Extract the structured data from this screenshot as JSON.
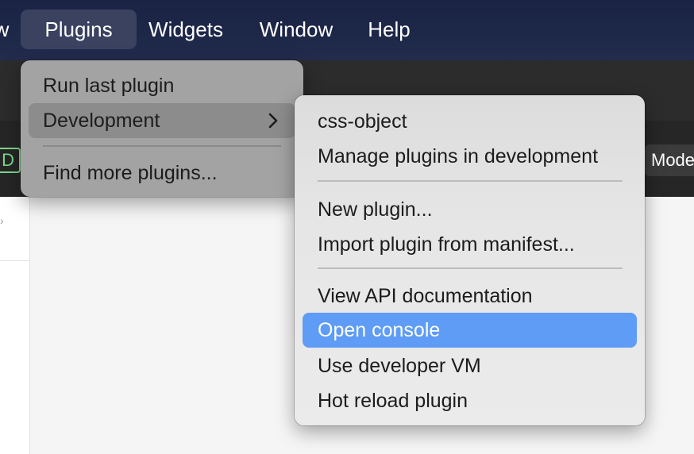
{
  "menubar": {
    "items": [
      {
        "label": "w"
      },
      {
        "label": "Plugins"
      },
      {
        "label": "Widgets"
      },
      {
        "label": "Window"
      },
      {
        "label": "Help"
      }
    ]
  },
  "toolbar": {
    "left_label": "k D",
    "mode_button": "Mode"
  },
  "plugins_menu": {
    "run_last": "Run last plugin",
    "development": "Development",
    "find_more": "Find more plugins..."
  },
  "development_menu": {
    "items": [
      {
        "label": "css-object"
      },
      {
        "label": "Manage plugins in development"
      },
      {
        "label": "New plugin..."
      },
      {
        "label": "Import plugin from manifest..."
      },
      {
        "label": "View API documentation"
      },
      {
        "label": "Open console"
      },
      {
        "label": "Use developer VM"
      },
      {
        "label": "Hot reload plugin"
      }
    ]
  },
  "colors": {
    "menubar_bg": "#1d2748",
    "highlight_blue": "#5e9cf6",
    "highlight_gray": "#8c8c8c"
  }
}
